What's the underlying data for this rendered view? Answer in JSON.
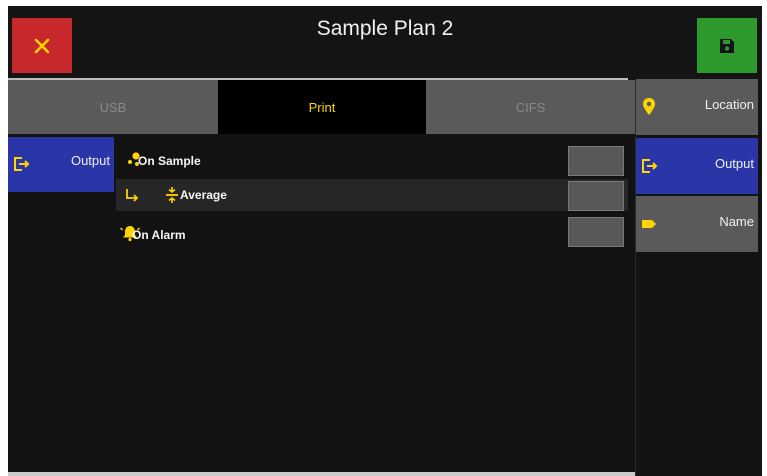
{
  "header": {
    "title": "Sample Plan 2",
    "close_icon": "close-x-icon",
    "save_icon": "floppy-disk-save-icon",
    "close_color": "#c6282b",
    "save_color": "#2e9a2e"
  },
  "tabs": [
    {
      "label": "USB",
      "active": false
    },
    {
      "label": "Print",
      "active": true
    },
    {
      "label": "CIFS",
      "active": false
    }
  ],
  "side_nav": {
    "label": "Output",
    "icon": "output-arrow-icon"
  },
  "right_nav": [
    {
      "label": "Location",
      "icon": "location-pin-icon",
      "active": false
    },
    {
      "label": "Output",
      "icon": "output-arrow-icon",
      "active": true
    },
    {
      "label": "Name",
      "icon": "tag-label-icon",
      "active": false
    }
  ],
  "rows": [
    {
      "label": "On Sample",
      "icon": "sample-dots-icon"
    },
    {
      "label": "Average",
      "icon": "average-icon",
      "sub_icon": "sub-arrow-icon"
    },
    {
      "label": "On Alarm",
      "icon": "alarm-bell-icon"
    }
  ],
  "colors": {
    "accent_yellow": "#ffd400",
    "active_blue": "#2a35a8",
    "inactive_gray": "#5a5a5a"
  }
}
